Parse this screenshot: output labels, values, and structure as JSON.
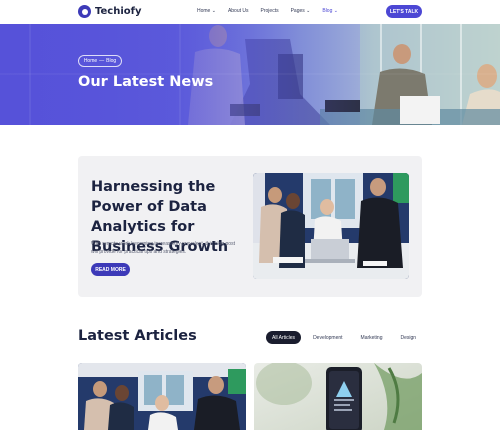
{
  "header": {
    "brand": "Techiofy",
    "nav": [
      {
        "label": "Home",
        "has_caret": true
      },
      {
        "label": "About Us",
        "has_caret": false
      },
      {
        "label": "Projects",
        "has_caret": false
      },
      {
        "label": "Pages",
        "has_caret": true
      },
      {
        "label": "Blog",
        "has_caret": true,
        "active": true
      }
    ],
    "caret": "⌄",
    "cta_label": "LET'S TALK"
  },
  "hero": {
    "breadcrumb": [
      "Home",
      "Blog"
    ],
    "breadcrumb_sep": "—",
    "title": "Our Latest News"
  },
  "featured": {
    "title": "Harnessing the Power of Data Analytics for Business Growth",
    "description": "With remote work becoming increasingly prevalent, this blog post will provide for practical tips and strategies.",
    "button": "READ MORE"
  },
  "latest": {
    "title": "Latest Articles",
    "filters": [
      "All Articles",
      "Development",
      "Marketing",
      "Design"
    ],
    "active_filter": "All Articles"
  },
  "colors": {
    "brand": "#4c47d4",
    "dark_brand": "#3d3ab8",
    "heading": "#1c2340"
  }
}
